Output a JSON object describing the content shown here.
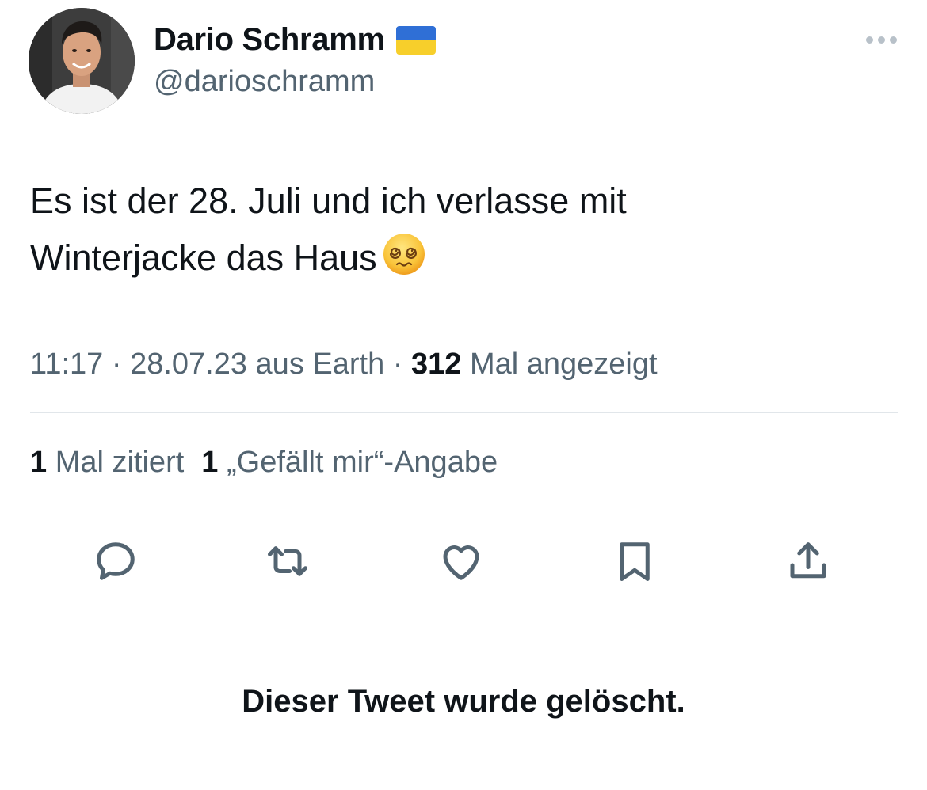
{
  "author": {
    "display_name": "Dario Schramm",
    "handle": "@darioschramm",
    "flag": "ukraine-flag",
    "avatar": "profile-photo"
  },
  "tweet": {
    "line1": "Es ist der 28. Juli und ich verlasse mit",
    "line2": "Winterjacke das Haus",
    "emoji": "face-with-spiral-eyes"
  },
  "meta": {
    "time": "11:17",
    "date": "28.07.23",
    "source": "aus Earth",
    "separator": "·",
    "views_count": "312",
    "views_label": "Mal angezeigt"
  },
  "stats": {
    "quotes_count": "1",
    "quotes_label": "Mal zitiert",
    "likes_count": "1",
    "likes_label": "„Gefällt mir“-Angabe"
  },
  "actions": [
    {
      "name": "reply",
      "icon": "reply-icon"
    },
    {
      "name": "retweet",
      "icon": "retweet-icon"
    },
    {
      "name": "like",
      "icon": "heart-icon"
    },
    {
      "name": "bookmark",
      "icon": "bookmark-icon"
    },
    {
      "name": "share",
      "icon": "share-icon"
    }
  ],
  "deleted_notice": "Dieser Tweet wurde gelöscht.",
  "colors": {
    "text": "#0f1419",
    "secondary": "#536471",
    "divider": "#e1e6ea",
    "flag_blue": "#2f6fd6",
    "flag_yellow": "#f7cf2b"
  }
}
